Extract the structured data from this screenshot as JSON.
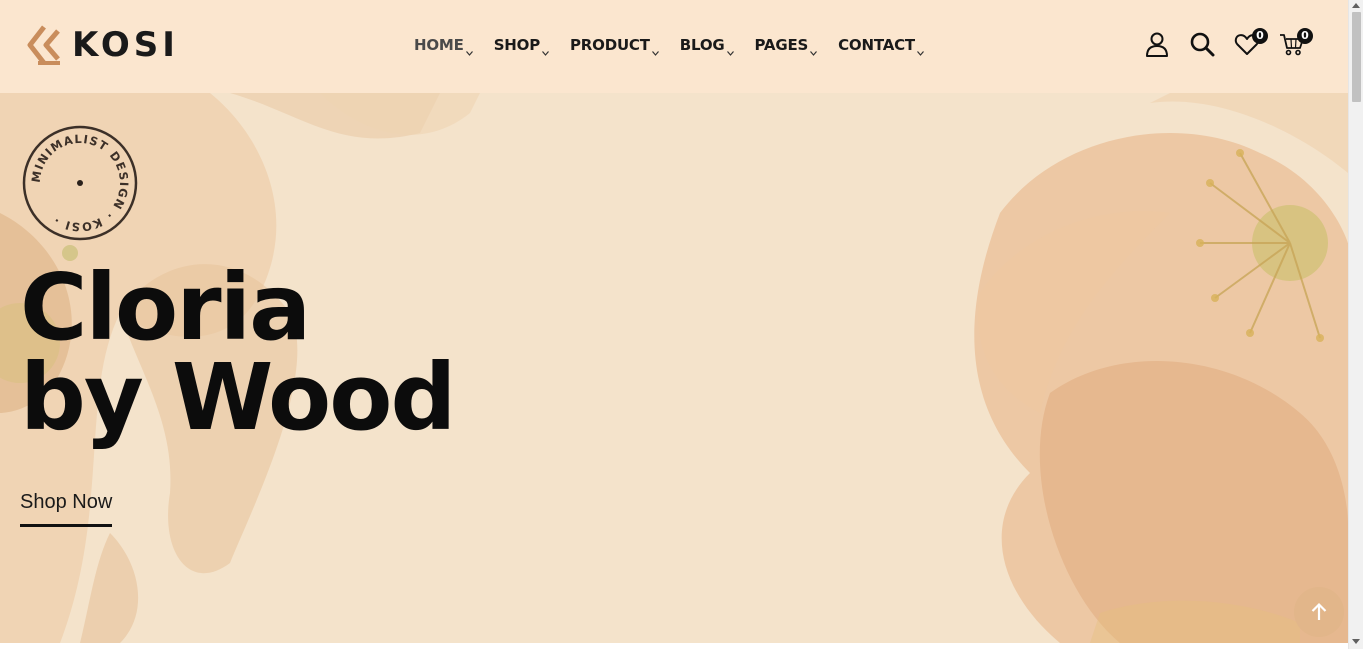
{
  "brand": {
    "name": "KOSI",
    "logo_color": "#c98d5c"
  },
  "nav": {
    "items": [
      {
        "label": "HOME",
        "active": true
      },
      {
        "label": "SHOP"
      },
      {
        "label": "PRODUCT"
      },
      {
        "label": "BLOG"
      },
      {
        "label": "PAGES"
      },
      {
        "label": "CONTACT"
      }
    ]
  },
  "header_icons": {
    "account": "user-icon",
    "search": "search-icon",
    "wishlist": {
      "icon": "heart-icon",
      "count": "0"
    },
    "cart": {
      "icon": "cart-icon",
      "count": "0"
    }
  },
  "hero": {
    "stamp_text": "MINIMALIST DESIGN · KOSI ·",
    "title_line1": "Cloria",
    "title_line2": "by Wood",
    "cta": "Shop Now"
  },
  "back_to_top": {
    "icon": "arrow-up-icon",
    "color": "#e2b68a"
  },
  "colors": {
    "header_bg": "#fbe6cf",
    "hero_bg": "#f4e3cb",
    "text": "#0c0c0c"
  }
}
